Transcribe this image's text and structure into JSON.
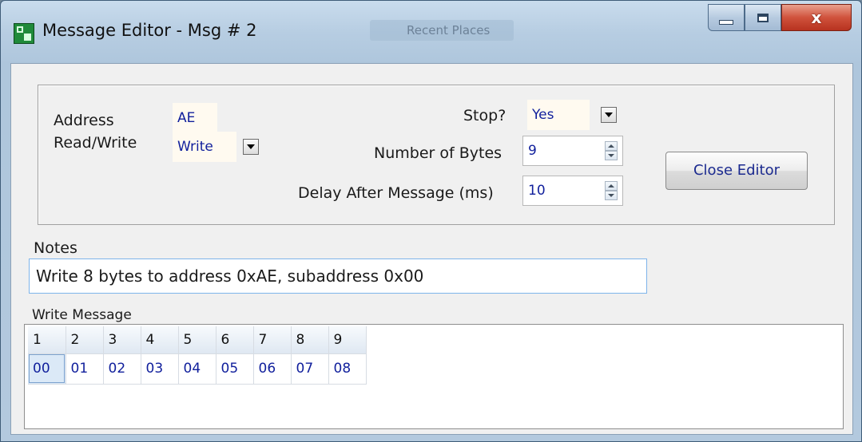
{
  "window": {
    "title": "Message Editor - Msg # 2",
    "background_window_text": "Recent Places",
    "controls": {
      "minimize": "minimize",
      "maximize": "maximize",
      "close": "x"
    }
  },
  "form": {
    "address_label": "Address",
    "address_value": "AE",
    "readwrite_label": "Read/Write",
    "readwrite_value": "Write",
    "stop_label": "Stop?",
    "stop_value": "Yes",
    "num_bytes_label": "Number of Bytes",
    "num_bytes_value": "9",
    "delay_label": "Delay After Message (ms)",
    "delay_value": "10",
    "close_button": "Close Editor"
  },
  "notes": {
    "label": "Notes",
    "value": "Write 8 bytes to address 0xAE, subaddress 0x00"
  },
  "write_message": {
    "label": "Write Message",
    "headers": [
      "1",
      "2",
      "3",
      "4",
      "5",
      "6",
      "7",
      "8",
      "9"
    ],
    "values": [
      "00",
      "01",
      "02",
      "03",
      "04",
      "05",
      "06",
      "07",
      "08"
    ],
    "selected_index": 0
  },
  "colors": {
    "value_text": "#101f9c",
    "input_focus_border": "#7eb4ea",
    "close_red": "#d0523c"
  }
}
